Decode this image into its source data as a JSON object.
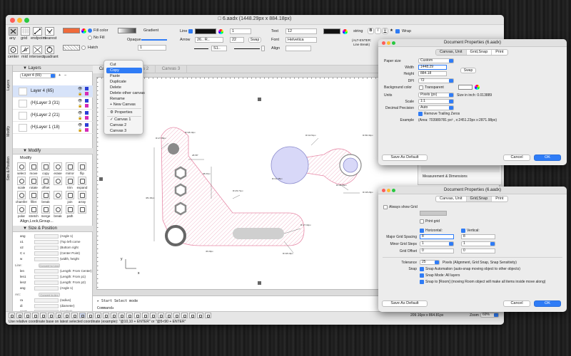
{
  "window": {
    "title": "6.aadx (1448.29px x 884.18px)"
  },
  "toolbar": {
    "tool_labels": [
      "any",
      "grid",
      "endpoint",
      "nearest",
      "center",
      "mid",
      "intersect",
      "quadrant"
    ],
    "fill_color_label": "Fill color",
    "no_fill_label": "No Fill",
    "hatch_label": "Hatch",
    "hatch_value": "1",
    "gradient_label": "Gradient",
    "opaque_label": "Opaque",
    "line_label": "Line",
    "line_width": "1",
    "arrow_label": "Arrow",
    "arrow_value": "26.. R..",
    "arrow_size": "22",
    "swap_label": "Swap",
    "dash_value": "S1..",
    "text_label": "Text",
    "text_size": "12",
    "font_label": "Font",
    "font_value": "Helvetica",
    "align_label": "Align",
    "string_label": "string",
    "style_b": "B",
    "style_i": "I",
    "style_u": "U",
    "wrap_label": "Wrap",
    "alt_enter": "(ALT-ENTER:",
    "line_break": "Line Break)"
  },
  "left_tabs": [
    "Layers",
    "Modify",
    "Size & Position"
  ],
  "layers": {
    "title": "Layers",
    "current": "Layer 4 (65)",
    "items": [
      {
        "name": "Layer 4 (65)"
      },
      {
        "name": "(H)Layer 3 (31)"
      },
      {
        "name": "(H)Layer 2 (21)"
      },
      {
        "name": "(H)Layer 1 (18)"
      }
    ]
  },
  "modify": {
    "title": "Modify",
    "subtitle": "Modify",
    "tools": [
      "select",
      "move",
      "copy",
      "erase",
      "mirror",
      "flip",
      "scale",
      "rotate",
      "offset",
      "",
      "trim",
      "expand",
      "chamfer",
      "fillet",
      "break",
      "",
      "join",
      "array",
      "polar",
      "stretch",
      "merge",
      "break",
      "path",
      ""
    ],
    "align_label": "Align,Lock,Group..."
  },
  "size_position": {
    "title": "Size & Position",
    "rows": [
      {
        "label": "ang",
        "desc": "(Angle 1)"
      },
      {
        "label": "x1",
        "desc": "(Top left corne"
      },
      {
        "label": "x2",
        "desc": "(Bottom right"
      },
      {
        "label": "C x",
        "desc": "(Center Point)"
      },
      {
        "label": "w",
        "desc": "(width, height"
      }
    ],
    "line_section": "Line:",
    "line_btn": "Convert to Line",
    "line_rows": [
      {
        "label": "len",
        "desc": "(Length: From Center)"
      },
      {
        "label": "len1",
        "desc": "(Length: From p1)"
      },
      {
        "label": "len2",
        "desc": "(Length: From p2)"
      },
      {
        "label": "ang",
        "desc": "(Angle 1)"
      }
    ],
    "arc_section": "Arc:",
    "arc_btn": "Convert to Arc",
    "arc_rows": [
      {
        "label": "ra",
        "desc": "(radius)"
      },
      {
        "label": "di",
        "desc": "(diameter)"
      },
      {
        "label": "ang1",
        "desc": "(Angle1)"
      },
      {
        "label": "ang2",
        "desc": "(Angle2)"
      }
    ]
  },
  "canvas_tabs": [
    "Canvas 1",
    "Canvas 2",
    "Canvas 3"
  ],
  "context_menu": {
    "items": [
      "Cut",
      "Copy",
      "Paste",
      "Duplicate",
      "Delete",
      "Delete other canvas",
      "Rename",
      "+ New Canvas",
      "Properties",
      "Canvas 1",
      "Canvas 2",
      "Canvas 3"
    ],
    "highlighted": "Copy",
    "checked": "Canvas 1"
  },
  "drawing": {
    "dims": [
      "R=27.89px",
      "R=48.19px",
      "28.58°",
      "38.07px",
      "481.00px",
      "R=29.71px",
      "R=27.02px",
      "R=48.19px",
      "R=44.51px",
      "R=80.34px",
      "R=41.08px",
      "R=46.96px",
      "R=48.29px",
      "45.00px"
    ],
    "axis_y": "y",
    "axis_x": "x"
  },
  "console": {
    "line1": "▸ Start Select mode",
    "prompt": "Command▸"
  },
  "status": {
    "coords": "209.16px x 864.81px",
    "zoom_label": "Zoom",
    "zoom_value": "69%",
    "hint": "Use relative coordinate base on latest selected coordinate (example): \"@10,10 + ENTER\" or \"@5<90 + ENTER\""
  },
  "dialog1": {
    "title": "Document Properties (6.aadx)",
    "tabs": [
      "Canvas, Unit",
      "Grid,Snap",
      "Print"
    ],
    "active_tab": "Canvas, Unit",
    "paper_size_label": "Paper size",
    "paper_size_value": "Custom",
    "width_label": "Width",
    "width_value": "1448.29",
    "height_label": "Height",
    "height_value": "884.18",
    "swap_label": "Swap",
    "dpi_label": "DPI",
    "dpi_value": "72",
    "bg_label": "Background color",
    "transparent_label": "Transparent",
    "units_label": "Units",
    "units_value": "Pixels (px)",
    "size_in_inch": "Size in inch: 0.013889",
    "scale_label": "Scale",
    "scale_value": "1:1",
    "decimal_label": "Decimal Precision",
    "decimal_value": "Auto",
    "trailing_label": "Remove Trailing Zeros",
    "example_label": "Example",
    "example_value": "(Area: 703989781 px² , x:2451.23px x:2871.98px)",
    "save_default": "Save As Default",
    "cancel": "Cancel",
    "ok": "OK"
  },
  "behind_panel": {
    "items": [
      "Measurement & Dimensions"
    ]
  },
  "dialog2": {
    "title": "Document Properties (6.aadx)",
    "tabs": [
      "Canvas, Unit",
      "Grid,Snap",
      "Print"
    ],
    "active_tab": "Grid,Snap",
    "always_show_grid": "Always show Grid",
    "print_grid": "Print grid",
    "horizontal_label": "Horizontal:",
    "vertical_label": "Vertical:",
    "major_label": "Major Grid Spacing",
    "major_h": "8",
    "major_v": "8",
    "minor_label": "Minor Grid Steps",
    "minor_h": "1",
    "minor_v": "1",
    "offset_label": "Grid Offset",
    "offset_h": "0",
    "offset_v": "0",
    "tolerance_label": "Tolerance",
    "tolerance_value": "25",
    "tolerance_desc": "Pixels (Alignment, Grid Snap, Snap Sensitivity)",
    "snap_label": "Snap",
    "snap_automation": "Snap Automation (auto-snap moving object to other objects)",
    "snap_mode": "Snap Mode: All layers",
    "snap_room": "Snap to [Room] (moving Room object will make all items inside move along)",
    "save_default": "Save As Default",
    "cancel": "Cancel",
    "ok": "OK"
  },
  "colors": {
    "accent": "#2f7cf6",
    "fill_color": "#f06a3a",
    "layer_active_bg": "#d7e3f9",
    "hatch_pink": "#e78aa8",
    "part_gray": "#8a8a8a"
  }
}
